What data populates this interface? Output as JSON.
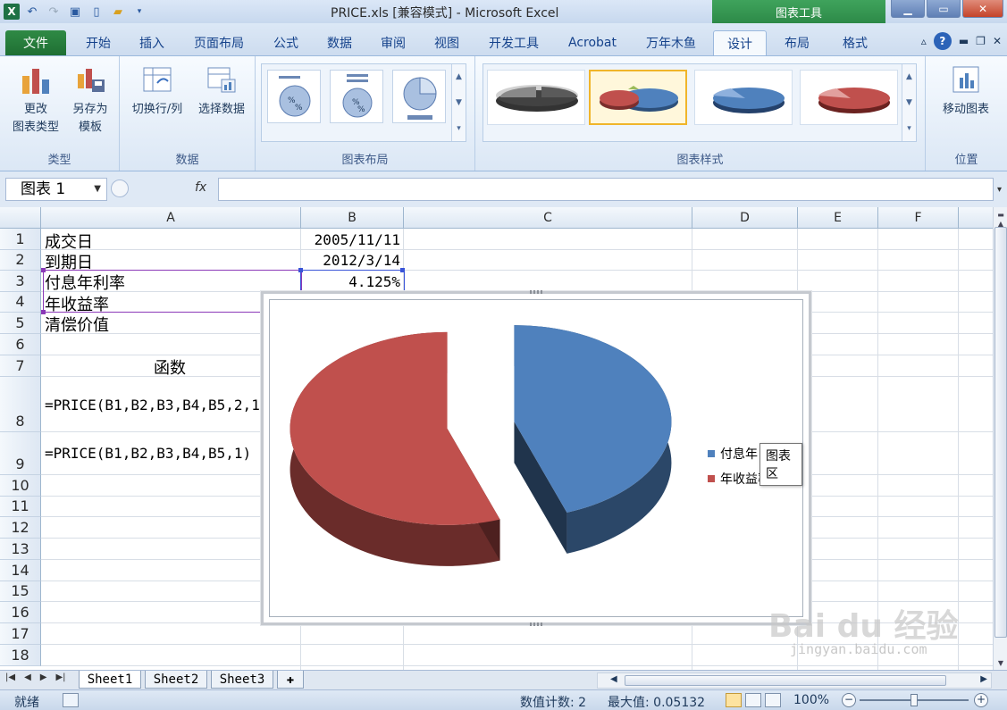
{
  "app": {
    "title": "PRICE.xls  [兼容模式]  -  Microsoft Excel",
    "context_tab_group": "图表工具",
    "qat_icons": [
      "excel-logo",
      "undo-icon",
      "redo-icon",
      "save-icon",
      "new-icon",
      "open-icon"
    ]
  },
  "tabs": {
    "file": "文件",
    "items": [
      "开始",
      "插入",
      "页面布局",
      "公式",
      "数据",
      "审阅",
      "视图",
      "开发工具",
      "Acrobat",
      "万年木鱼",
      "设计",
      "布局",
      "格式"
    ],
    "active": "设计"
  },
  "ribbon": {
    "type_group": {
      "label": "类型",
      "change_type": "更改\n图表类型",
      "save_template": "另存为\n模板"
    },
    "data_group": {
      "label": "数据",
      "switch_row_col": "切换行/列",
      "select_data": "选择数据"
    },
    "layout_group": {
      "label": "图表布局"
    },
    "style_group": {
      "label": "图表样式"
    },
    "position_group": {
      "label": "位置",
      "move_chart": "移动图表"
    }
  },
  "formula_bar": {
    "name_box": "图表 1",
    "fx": "fx",
    "value": ""
  },
  "columns": [
    "A",
    "B",
    "C",
    "D",
    "E",
    "F"
  ],
  "rows": [
    "1",
    "2",
    "3",
    "4",
    "5",
    "6",
    "7",
    "8",
    "9",
    "10",
    "11",
    "12",
    "13",
    "14",
    "15",
    "16",
    "17",
    "18"
  ],
  "cells": {
    "A1": "成交日",
    "B1": "2005/11/11",
    "A2": "到期日",
    "B2": "2012/3/14",
    "A3": "付息年利率",
    "B3": "4.125%",
    "A4": "年收益率",
    "A5": "清偿价值",
    "A7": "函数",
    "A8": "=PRICE(B1,B2,B3,B4,B5,2,1",
    "A9": "=PRICE(B1,B2,B3,B4,B5,1)"
  },
  "chart_data": {
    "type": "pie",
    "title": "",
    "series": [
      {
        "name": "付息年利率",
        "value": 0.04125,
        "color": "#4f81bd"
      },
      {
        "name": "年收益率",
        "value": 0.05132,
        "color": "#c0504d"
      }
    ],
    "legend_position": "right",
    "legend_visible_text": [
      "付息年",
      "年收益率"
    ],
    "exploded": true,
    "three_d": true
  },
  "tooltip": "图表区",
  "sheets": [
    "Sheet1",
    "Sheet2",
    "Sheet3"
  ],
  "active_sheet": "Sheet1",
  "status": {
    "mode": "就绪",
    "count_label": "数值计数: 2",
    "max_label": "最大值: 0.05132",
    "zoom": "100%"
  },
  "watermark": {
    "main": "Bai du 经验",
    "sub": "jingyan.baidu.com"
  }
}
